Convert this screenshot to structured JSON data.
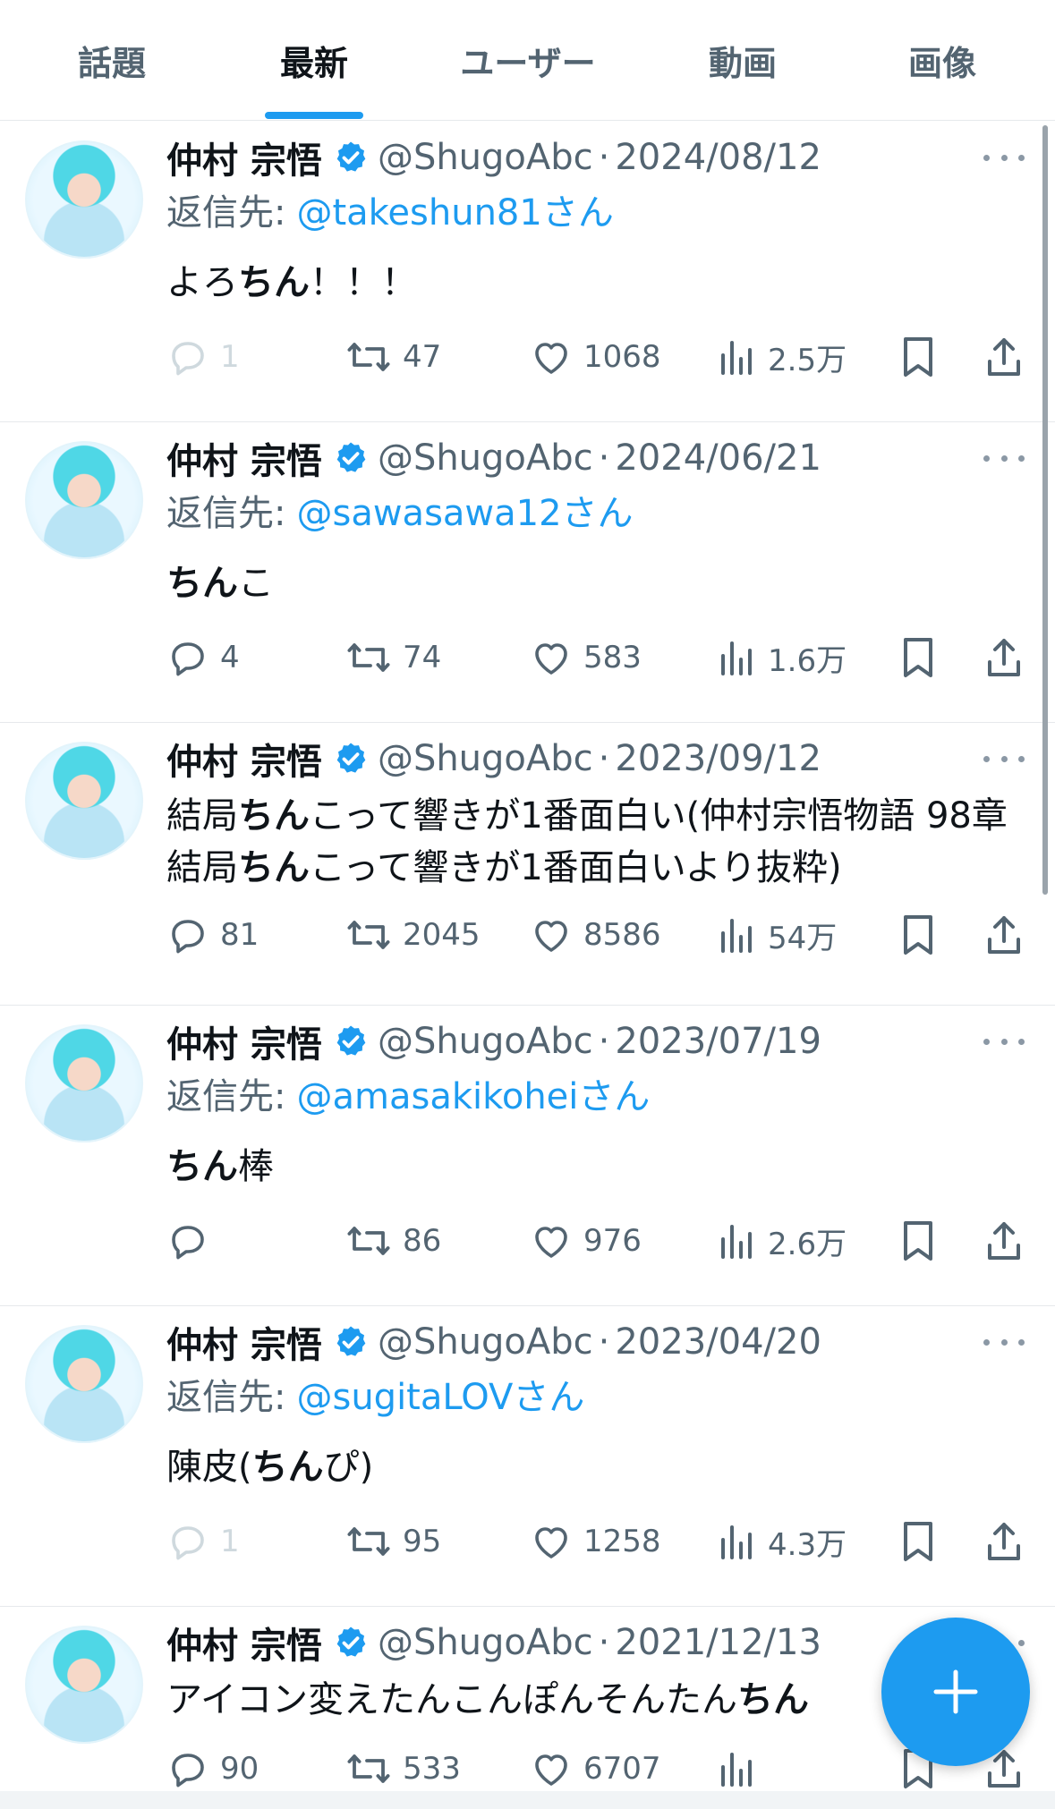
{
  "tabs": [
    {
      "label": "話題"
    },
    {
      "label": "最新"
    },
    {
      "label": "ユーザー"
    },
    {
      "label": "動画"
    },
    {
      "label": "画像"
    }
  ],
  "active_tab": "最新",
  "accent_color": "#1d9bf0",
  "tweets": [
    {
      "name": "仲村 宗悟",
      "handle": "@ShugoAbc",
      "separator": "·",
      "date": "2024/08/12",
      "reply_prefix": "返信先:",
      "reply_to": "@takeshun81さん",
      "body": [
        [
          "よろ",
          false
        ],
        [
          "ちん",
          true
        ],
        [
          "！！！",
          false
        ]
      ],
      "replies": "1",
      "retweets": "47",
      "likes": "1068",
      "views": "2.5万"
    },
    {
      "name": "仲村 宗悟",
      "handle": "@ShugoAbc",
      "separator": "·",
      "date": "2024/06/21",
      "reply_prefix": "返信先:",
      "reply_to": "@sawasawa12さん",
      "body": [
        [
          "ちん",
          true
        ],
        [
          "こ",
          false
        ]
      ],
      "replies": "4",
      "retweets": "74",
      "likes": "583",
      "views": "1.6万"
    },
    {
      "name": "仲村 宗悟",
      "handle": "@ShugoAbc",
      "separator": "·",
      "date": "2023/09/12",
      "body": [
        [
          "結局",
          false
        ],
        [
          "ちん",
          true
        ],
        [
          "こって響きが1番面白い(仲村宗悟物語 98章 結局",
          false
        ],
        [
          "ちん",
          true
        ],
        [
          "こって響きが1番面白いより抜粋)",
          false
        ]
      ],
      "replies": "81",
      "retweets": "2045",
      "likes": "8586",
      "views": "54万"
    },
    {
      "name": "仲村 宗悟",
      "handle": "@ShugoAbc",
      "separator": "·",
      "date": "2023/07/19",
      "reply_prefix": "返信先:",
      "reply_to": "@amasakikoheiさん",
      "body": [
        [
          "ちん",
          true
        ],
        [
          "棒",
          false
        ]
      ],
      "replies": "",
      "retweets": "86",
      "likes": "976",
      "views": "2.6万"
    },
    {
      "name": "仲村 宗悟",
      "handle": "@ShugoAbc",
      "separator": "·",
      "date": "2023/04/20",
      "reply_prefix": "返信先:",
      "reply_to": "@sugitaLOVさん",
      "body": [
        [
          "陳皮(",
          false
        ],
        [
          "ちん",
          true
        ],
        [
          "ぴ)",
          false
        ]
      ],
      "replies": "1",
      "retweets": "95",
      "likes": "1258",
      "views": "4.3万"
    },
    {
      "name": "仲村 宗悟",
      "handle": "@ShugoAbc",
      "separator": "·",
      "date": "2021/12/13",
      "body": [
        [
          "アイコン変えたんこんぽんそんたん",
          false
        ],
        [
          "ちん",
          true
        ]
      ],
      "replies": "90",
      "retweets": "533",
      "likes": "6707",
      "views": ""
    }
  ],
  "icons": {
    "verified": "verified-badge-icon",
    "reply": "reply-icon",
    "retweet": "retweet-icon",
    "like": "like-icon",
    "views": "views-icon",
    "bookmark": "bookmark-icon",
    "share": "share-icon",
    "more": "more-icon",
    "compose": "plus-icon"
  }
}
